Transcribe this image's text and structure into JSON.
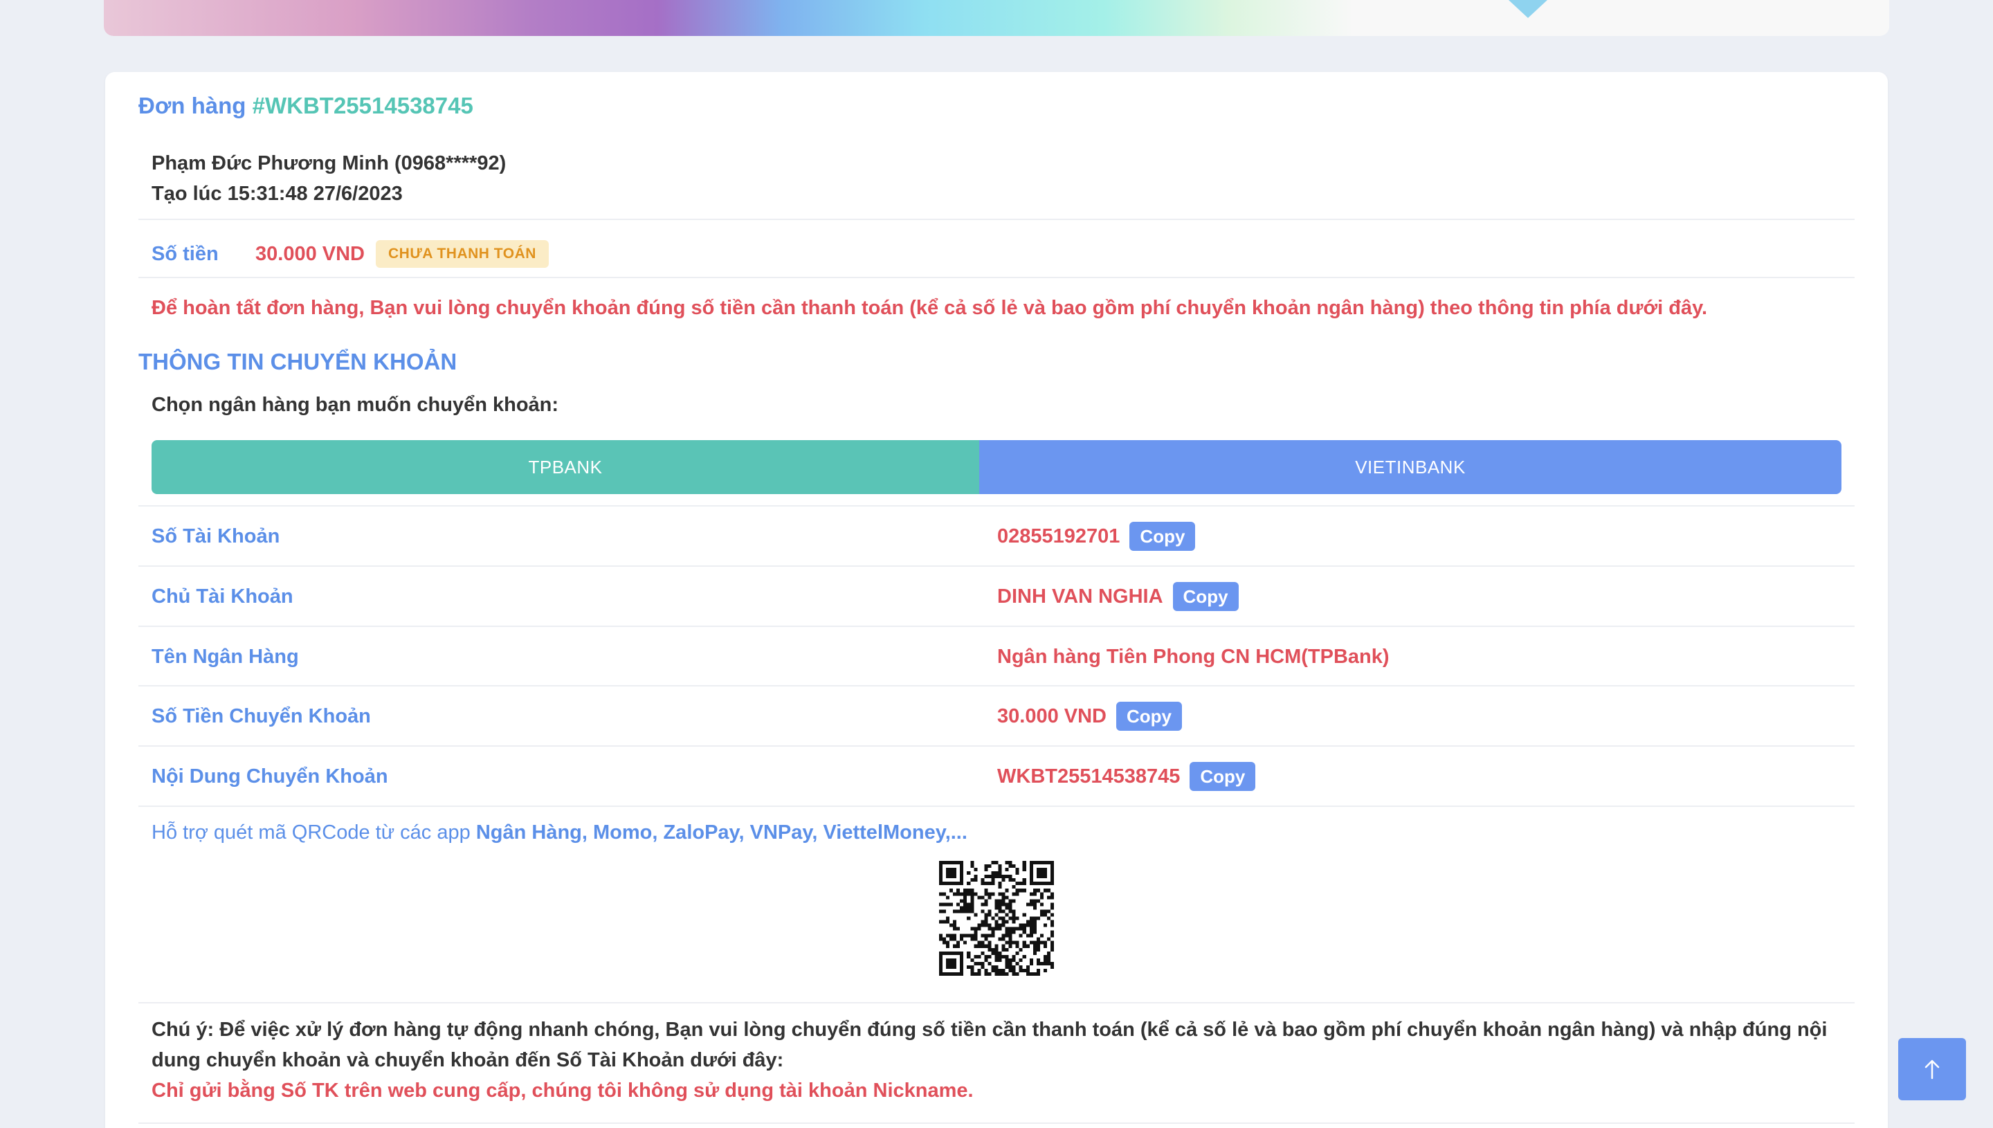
{
  "order": {
    "title_prefix": "Đơn hàng",
    "code": "#WKBT25514538745",
    "customer_line": "Phạm Đức Phương Minh (0968****92)",
    "created_line": "Tạo lúc 15:31:48 27/6/2023",
    "amount_label": "Số tiền",
    "amount_value": "30.000 VND",
    "status": "CHƯA THANH TOÁN",
    "notice": "Để hoàn tất đơn hàng, Bạn vui lòng chuyển khoản đúng số tiền cần thanh toán (kể cả số lẻ và bao gồm phí chuyển khoản ngân hàng) theo thông tin phía dưới đây."
  },
  "transfer": {
    "section_title": "THÔNG TIN CHUYỂN KHOẢN",
    "choose_label": "Chọn ngân hàng bạn muốn chuyển khoản:",
    "tabs": [
      "TPBANK",
      "VIETINBANK"
    ],
    "copy_label": "Copy",
    "rows": [
      {
        "label": "Số Tài Khoản",
        "value": "02855192701"
      },
      {
        "label": "Chủ Tài Khoản",
        "value": "DINH VAN NGHIA"
      },
      {
        "label": "Tên Ngân Hàng",
        "value": "Ngân hàng Tiên Phong CN HCM(TPBank)"
      },
      {
        "label": "Số Tiền Chuyển Khoản",
        "value": "30.000 VND"
      },
      {
        "label": "Nội Dung Chuyển Khoản",
        "value": "WKBT25514538745"
      }
    ],
    "qr_hint": "Hỗ trợ quét mã QRCode từ các app",
    "qr_apps": "Ngân Hàng, Momo, ZaloPay, VNPay, ViettelMoney,..."
  },
  "footnote": {
    "text": "Chú ý: Để việc xử lý đơn hàng tự động nhanh chóng, Bạn vui lòng chuyển đúng số tiền cần thanh toán (kể cả số lẻ và bao gồm phí chuyển khoản ngân hàng) và nhập đúng nội dung chuyển khoản và chuyển khoản đến Số Tài Khoản dưới đây:",
    "warning": "Chỉ gửi bằng Số TK trên web cung cấp, chúng tôi không sử dụng tài khoản Nickname."
  },
  "colors": {
    "accent_blue": "#5b8fe8",
    "accent_teal": "#55c5b5",
    "danger_red": "#e0505a",
    "button_blue": "#6b96f0"
  },
  "icons": {
    "scroll_top": "arrow-up-icon",
    "qr": "qr-code-icon"
  }
}
